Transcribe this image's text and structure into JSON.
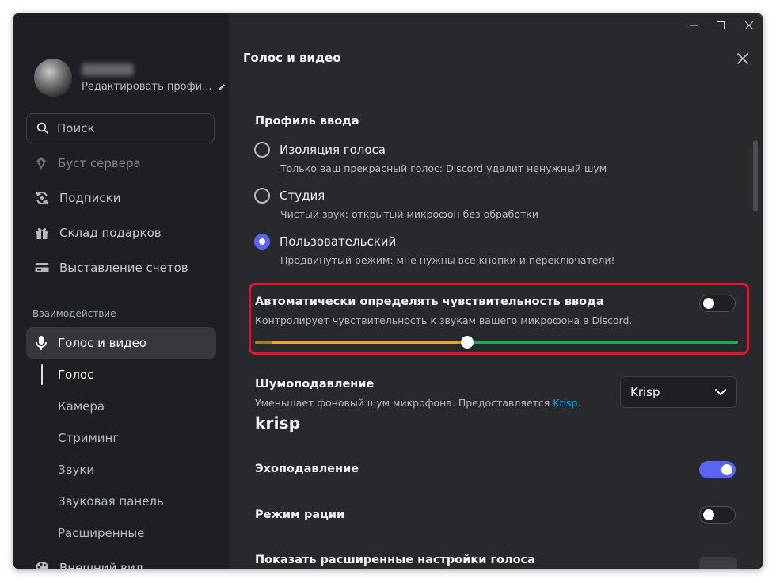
{
  "window": {
    "controls": [
      "minimize-icon",
      "maximize-icon",
      "close-icon"
    ]
  },
  "profile": {
    "edit_label": "Редактировать профи...",
    "edit_icon": "pencil-icon"
  },
  "search": {
    "placeholder": "Поиск",
    "icon": "search-icon"
  },
  "sidebar": {
    "items": [
      {
        "label": "Буст сервера",
        "icon": "boost-icon"
      },
      {
        "label": "Подписки",
        "icon": "refresh-icon"
      },
      {
        "label": "Склад подарков",
        "icon": "gift-icon"
      },
      {
        "label": "Выставление счетов",
        "icon": "card-icon"
      }
    ],
    "section_label": "Взаимодействие",
    "active_item": {
      "label": "Голос и видео",
      "icon": "microphone-icon"
    },
    "sub_items": [
      "Голос",
      "Камера",
      "Стриминг",
      "Звуки",
      "Звуковая панель",
      "Расширенные"
    ],
    "partial_item": {
      "label": "Внешний вид",
      "icon": "palette-icon"
    }
  },
  "content": {
    "title": "Голос и видео",
    "input_profile": {
      "heading": "Профиль ввода",
      "options": [
        {
          "label": "Изоляция голоса",
          "desc": "Только ваш прекрасный голос: Discord удалит ненужный шум",
          "selected": false
        },
        {
          "label": "Студия",
          "desc": "Чистый звук: открытый микрофон без обработки",
          "selected": false
        },
        {
          "label": "Пользовательский",
          "desc": "Продвинутый режим: мне нужны все кнопки и переключатели!",
          "selected": true
        }
      ]
    },
    "sensitivity": {
      "heading": "Автоматически определять чувствительность ввода",
      "desc": "Контролирует чувствительность к звукам вашего микрофона в Discord.",
      "enabled": false,
      "threshold_fraction": 0.44,
      "level_fraction": 0.035
    },
    "noise": {
      "heading": "Шумоподавление",
      "desc_prefix": "Уменьшает фоновый шум микрофона. Предоставляется ",
      "desc_link": "Krisp",
      "desc_suffix": ".",
      "logo": "krisp",
      "select_value": "Krisp"
    },
    "echo": {
      "label": "Эхоподавление",
      "enabled": true
    },
    "ptt": {
      "label": "Режим рации",
      "enabled": false
    },
    "advanced": {
      "label": "Показать расширенные настройки голоса"
    }
  },
  "colors": {
    "accent": "#5865f2",
    "slider_low": "#e8a53a",
    "slider_high": "#23a559",
    "highlight": "#e8132c"
  }
}
